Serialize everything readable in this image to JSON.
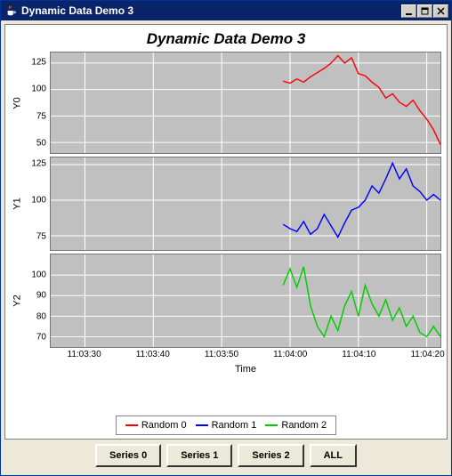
{
  "window": {
    "title": "Dynamic Data Demo 3",
    "icon": "java-coffee-icon"
  },
  "chart_title": "Dynamic Data Demo 3",
  "x_axis_label": "Time",
  "x_ticks": [
    "11:03:30",
    "11:03:40",
    "11:03:50",
    "11:04:00",
    "11:04:10",
    "11:04:20"
  ],
  "panels": [
    {
      "label": "Y0",
      "ticks": [
        50,
        75,
        100,
        125
      ],
      "min": 40,
      "max": 135
    },
    {
      "label": "Y1",
      "ticks": [
        75,
        100,
        125
      ],
      "min": 65,
      "max": 130
    },
    {
      "label": "Y2",
      "ticks": [
        70,
        80,
        90,
        100
      ],
      "min": 65,
      "max": 110
    }
  ],
  "legend": [
    {
      "label": "Random 0",
      "color": "#ff0000"
    },
    {
      "label": "Random 1",
      "color": "#0000ff"
    },
    {
      "label": "Random 2",
      "color": "#00cc00"
    }
  ],
  "buttons": [
    "Series 0",
    "Series 1",
    "Series 2",
    "ALL"
  ],
  "chart_data": [
    {
      "type": "line",
      "title": "",
      "xlabel": "Time",
      "ylabel": "Y0",
      "ylim": [
        40,
        135
      ],
      "xlim": [
        "11:03:25",
        "11:04:22"
      ],
      "series": [
        {
          "name": "Random 0",
          "color": "#ff0000",
          "x": [
            "11:03:59",
            "11:04:00",
            "11:04:01",
            "11:04:02",
            "11:04:03",
            "11:04:04",
            "11:04:05",
            "11:04:06",
            "11:04:07",
            "11:04:08",
            "11:04:09",
            "11:04:10",
            "11:04:11",
            "11:04:12",
            "11:04:13",
            "11:04:14",
            "11:04:15",
            "11:04:16",
            "11:04:17",
            "11:04:18",
            "11:04:19",
            "11:04:20",
            "11:04:21",
            "11:04:22"
          ],
          "values": [
            108,
            106,
            110,
            107,
            112,
            116,
            120,
            125,
            132,
            125,
            130,
            115,
            113,
            107,
            102,
            92,
            96,
            88,
            84,
            90,
            80,
            72,
            62,
            48
          ]
        }
      ]
    },
    {
      "type": "line",
      "title": "",
      "xlabel": "Time",
      "ylabel": "Y1",
      "ylim": [
        65,
        130
      ],
      "xlim": [
        "11:03:25",
        "11:04:22"
      ],
      "series": [
        {
          "name": "Random 1",
          "color": "#0000ff",
          "x": [
            "11:03:59",
            "11:04:00",
            "11:04:01",
            "11:04:02",
            "11:04:03",
            "11:04:04",
            "11:04:05",
            "11:04:06",
            "11:04:07",
            "11:04:08",
            "11:04:09",
            "11:04:10",
            "11:04:11",
            "11:04:12",
            "11:04:13",
            "11:04:14",
            "11:04:15",
            "11:04:16",
            "11:04:17",
            "11:04:18",
            "11:04:19",
            "11:04:20",
            "11:04:21",
            "11:04:22"
          ],
          "values": [
            83,
            80,
            78,
            85,
            76,
            80,
            90,
            82,
            74,
            84,
            93,
            95,
            100,
            110,
            105,
            115,
            126,
            115,
            122,
            110,
            106,
            100,
            104,
            100
          ]
        }
      ]
    },
    {
      "type": "line",
      "title": "",
      "xlabel": "Time",
      "ylabel": "Y2",
      "ylim": [
        65,
        110
      ],
      "xlim": [
        "11:03:25",
        "11:04:22"
      ],
      "series": [
        {
          "name": "Random 2",
          "color": "#00cc00",
          "x": [
            "11:03:59",
            "11:04:00",
            "11:04:01",
            "11:04:02",
            "11:04:03",
            "11:04:04",
            "11:04:05",
            "11:04:06",
            "11:04:07",
            "11:04:08",
            "11:04:09",
            "11:04:10",
            "11:04:11",
            "11:04:12",
            "11:04:13",
            "11:04:14",
            "11:04:15",
            "11:04:16",
            "11:04:17",
            "11:04:18",
            "11:04:19",
            "11:04:20",
            "11:04:21",
            "11:04:22"
          ],
          "values": [
            95,
            103,
            94,
            104,
            85,
            75,
            70,
            80,
            73,
            85,
            92,
            80,
            95,
            86,
            80,
            88,
            78,
            84,
            75,
            80,
            72,
            70,
            75,
            70
          ]
        }
      ]
    }
  ]
}
